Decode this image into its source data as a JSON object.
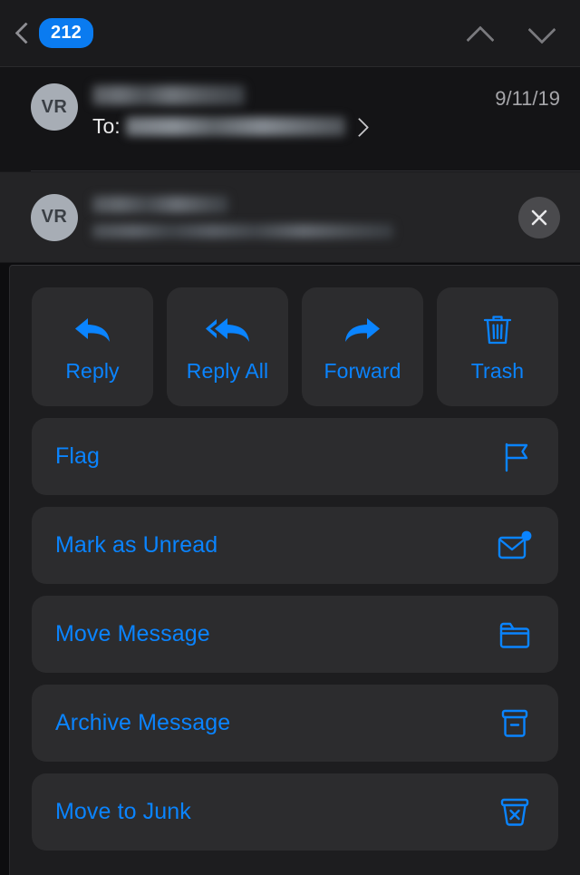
{
  "navbar": {
    "back_icon": "chevron-left-icon",
    "badge_count": "212",
    "prev_icon": "chevron-up-icon",
    "next_icon": "chevron-down-icon"
  },
  "message_header": {
    "avatar_initials": "VR",
    "sender_name": "",
    "to_label": "To:",
    "recipient": "",
    "date": "9/11/19",
    "detail_icon": "chevron-right-icon"
  },
  "preview_card": {
    "avatar_initials": "VR",
    "title": "",
    "subtitle": "",
    "close_icon": "close-icon"
  },
  "actions": {
    "quick": [
      {
        "label": "Reply",
        "icon": "reply-icon"
      },
      {
        "label": "Reply All",
        "icon": "reply-all-icon"
      },
      {
        "label": "Forward",
        "icon": "forward-icon"
      },
      {
        "label": "Trash",
        "icon": "trash-icon"
      }
    ],
    "list": [
      {
        "label": "Flag",
        "icon": "flag-icon"
      },
      {
        "label": "Mark as Unread",
        "icon": "envelope-badge-icon"
      },
      {
        "label": "Move Message",
        "icon": "folder-icon"
      },
      {
        "label": "Archive Message",
        "icon": "archive-box-icon"
      },
      {
        "label": "Move to Junk",
        "icon": "junk-bin-icon"
      }
    ]
  },
  "colors": {
    "accent_blue": "#0a84ff",
    "badge_blue": "#0a7bf0",
    "sheet_bg": "#1d1d1f",
    "card_bg": "#2c2c2e",
    "page_bg": "#0d0d0f",
    "avatar_bg": "#a7adb5",
    "muted_text": "#a6a6aa"
  }
}
